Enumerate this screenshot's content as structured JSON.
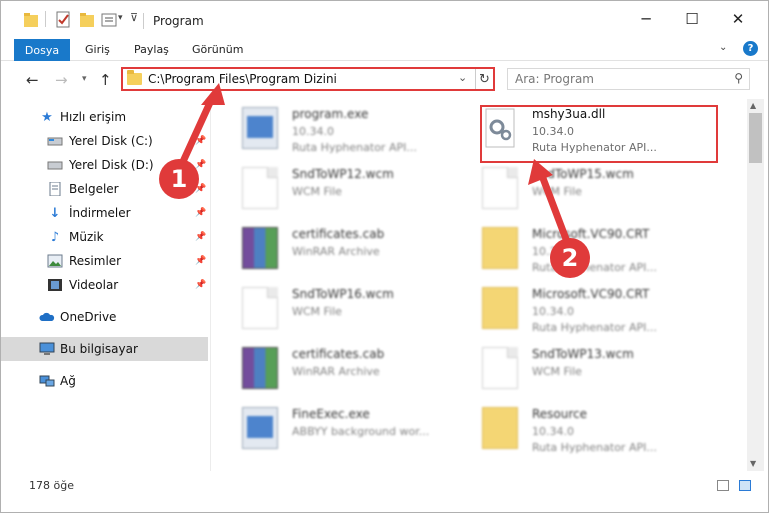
{
  "window": {
    "title": "Program",
    "controls": {
      "minimize": "─",
      "maximize": "☐",
      "close": "✕"
    }
  },
  "ribbon": {
    "file_tab": "Dosya",
    "tabs": [
      "Giriş",
      "Paylaş",
      "Görünüm"
    ],
    "help": "?"
  },
  "nav": {
    "address": "C:\\Program Files\\Program Dizini",
    "search_placeholder": "Ara: Program"
  },
  "sidebar": {
    "items": [
      {
        "label": "Hızlı erişim",
        "icon": "star-icon",
        "pinned": false
      },
      {
        "label": "Yerel Disk (C:)",
        "icon": "drive-icon",
        "pinned": true
      },
      {
        "label": "Yerel Disk (D:)",
        "icon": "drive-icon",
        "pinned": true
      },
      {
        "label": "Belgeler",
        "icon": "documents-icon",
        "pinned": true
      },
      {
        "label": "İndirmeler",
        "icon": "download-icon",
        "pinned": true
      },
      {
        "label": "Müzik",
        "icon": "music-icon",
        "pinned": true
      },
      {
        "label": "Resimler",
        "icon": "pictures-icon",
        "pinned": true
      },
      {
        "label": "Videolar",
        "icon": "videos-icon",
        "pinned": true
      },
      {
        "label": "OneDrive",
        "icon": "cloud-icon",
        "pinned": false
      },
      {
        "label": "Bu bilgisayar",
        "icon": "computer-icon",
        "pinned": false,
        "selected": true
      },
      {
        "label": "Ağ",
        "icon": "network-icon",
        "pinned": false
      }
    ]
  },
  "files": [
    {
      "name": "program.exe",
      "sub": "10.34.0",
      "sub2": "Ruta Hyphenator API...",
      "icon": "installer-icon"
    },
    {
      "name": "mshy3ua.dll",
      "sub": "10.34.0",
      "sub2": "Ruta Hyphenator API...",
      "icon": "dll-gear-icon",
      "highlighted": true
    },
    {
      "name": "SndToWP12.wcm",
      "sub": "WCM File",
      "sub2": "",
      "icon": "document-icon"
    },
    {
      "name": "SndToWP15.wcm",
      "sub": "WCM File",
      "sub2": "",
      "icon": "document-icon"
    },
    {
      "name": "certificates.cab",
      "sub": "WinRAR Archive",
      "sub2": "",
      "icon": "winrar-icon"
    },
    {
      "name": "Microsoft.VC90.CRT",
      "sub": "10.34.0",
      "sub2": "Ruta Hyphenator API...",
      "icon": "zip-folder-icon"
    },
    {
      "name": "SndToWP16.wcm",
      "sub": "WCM File",
      "sub2": "",
      "icon": "document-icon"
    },
    {
      "name": "Microsoft.VC90.CRT",
      "sub": "10.34.0",
      "sub2": "Ruta Hyphenator API...",
      "icon": "zip-folder-icon"
    },
    {
      "name": "certificates.cab",
      "sub": "WinRAR Archive",
      "sub2": "",
      "icon": "winrar-icon"
    },
    {
      "name": "SndToWP13.wcm",
      "sub": "WCM File",
      "sub2": "",
      "icon": "document-icon"
    },
    {
      "name": "FineExec.exe",
      "sub": "ABBYY background wor...",
      "sub2": "",
      "icon": "exe-icon"
    },
    {
      "name": "Resource",
      "sub": "10.34.0",
      "sub2": "Ruta Hyphenator API...",
      "icon": "zip-folder-icon"
    }
  ],
  "status": {
    "count": "178 öğe"
  },
  "annotations": {
    "step1": "1",
    "step2": "2",
    "color": "#e03a3a"
  }
}
